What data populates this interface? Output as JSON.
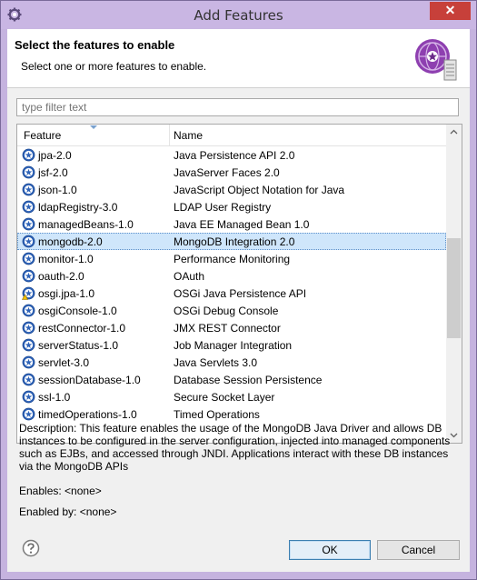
{
  "window": {
    "title": "Add Features",
    "close_label": "✕"
  },
  "header": {
    "title": "Select the features to enable",
    "subtitle": "Select one or more features to enable."
  },
  "filter": {
    "placeholder": "type filter text",
    "value": ""
  },
  "table": {
    "columns": [
      "Feature",
      "Name"
    ],
    "rows": [
      {
        "feature": "jpa-2.0",
        "name": "Java Persistence API 2.0",
        "icon": "feature-icon",
        "selected": false
      },
      {
        "feature": "jsf-2.0",
        "name": "JavaServer Faces 2.0",
        "icon": "feature-icon",
        "selected": false
      },
      {
        "feature": "json-1.0",
        "name": "JavaScript Object Notation for Java",
        "icon": "feature-icon",
        "selected": false
      },
      {
        "feature": "ldapRegistry-3.0",
        "name": "LDAP User Registry",
        "icon": "feature-icon",
        "selected": false
      },
      {
        "feature": "managedBeans-1.0",
        "name": "Java EE Managed Bean 1.0",
        "icon": "feature-icon",
        "selected": false
      },
      {
        "feature": "mongodb-2.0",
        "name": "MongoDB Integration 2.0",
        "icon": "feature-icon",
        "selected": true
      },
      {
        "feature": "monitor-1.0",
        "name": "Performance Monitoring",
        "icon": "feature-icon",
        "selected": false
      },
      {
        "feature": "oauth-2.0",
        "name": "OAuth",
        "icon": "feature-icon",
        "selected": false
      },
      {
        "feature": "osgi.jpa-1.0",
        "name": "OSGi Java Persistence API",
        "icon": "feature-warning-icon",
        "selected": false
      },
      {
        "feature": "osgiConsole-1.0",
        "name": "OSGi Debug Console",
        "icon": "feature-icon",
        "selected": false
      },
      {
        "feature": "restConnector-1.0",
        "name": "JMX REST Connector",
        "icon": "feature-icon",
        "selected": false
      },
      {
        "feature": "serverStatus-1.0",
        "name": "Job Manager Integration",
        "icon": "feature-icon",
        "selected": false
      },
      {
        "feature": "servlet-3.0",
        "name": "Java Servlets 3.0",
        "icon": "feature-icon",
        "selected": false
      },
      {
        "feature": "sessionDatabase-1.0",
        "name": "Database Session Persistence",
        "icon": "feature-icon",
        "selected": false
      },
      {
        "feature": "ssl-1.0",
        "name": "Secure Socket Layer",
        "icon": "feature-icon",
        "selected": false
      },
      {
        "feature": "timedOperations-1.0",
        "name": "Timed Operations",
        "icon": "feature-icon",
        "selected": false
      }
    ]
  },
  "description": "Description: This feature enables the usage of the MongoDB Java Driver and allows DB instances to be configured in the server configuration, injected into managed components such as EJBs, and accessed through JNDI. Applications interact with these DB instances via the MongoDB APIs",
  "enables": "Enables: <none>",
  "enabled_by": "Enabled by: <none>",
  "buttons": {
    "ok": "OK",
    "cancel": "Cancel"
  },
  "colors": {
    "titlebar": "#c9b6e3",
    "close": "#c7403a",
    "selection": "#cfe6fb",
    "accent": "#3c7fb1"
  }
}
